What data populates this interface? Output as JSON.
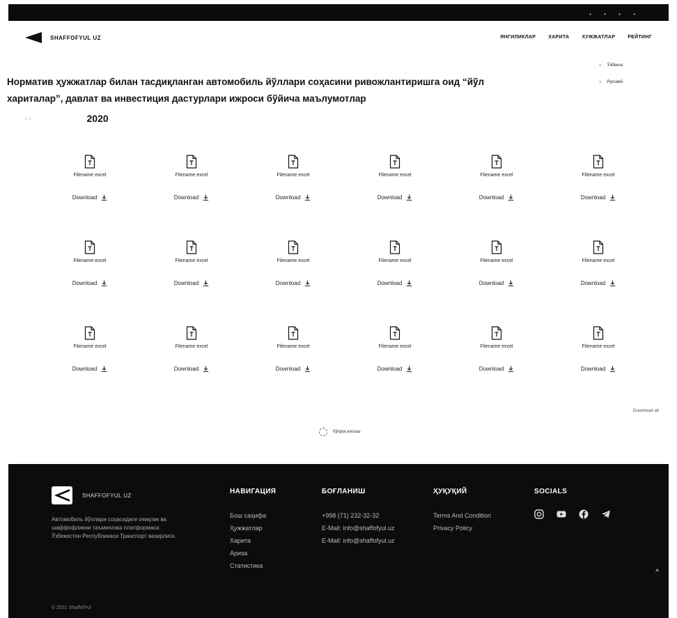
{
  "header": {
    "logo_text": "SHAFFOFYUL UZ",
    "nav": [
      "ЯНГИЛИКЛАР",
      "ХАРИТА",
      "ХУЖЖАТЛАР",
      "РЕЙТИНГ"
    ],
    "languages": [
      "Ўзбекча",
      "Русский"
    ]
  },
  "page": {
    "title": "Норматив ҳужжатлар билан тасдиқланган автомобиль йўллари соҳасини ривожлантиришга оид “йўл хариталар”, давлат ва инвестиция дастурлари ижроси бўйича маълумотлар",
    "year": "2020"
  },
  "files": {
    "filename_label": "Filename excel",
    "download_label": "Download",
    "count": 18
  },
  "download_all": "Download all",
  "loader_text": "Кўпроқ юклаш",
  "footer": {
    "logo_text": "SHAFFOFYUL UZ",
    "about": "Автомобиль йўллари соҳасидаги очиқлик ва шаффофликни таъминлаш платформаси. Ўзбекистон Республикаси Транспорт вазирлиги.",
    "nav_title": "НАВИГАЦИЯ",
    "nav_items": [
      "Бош саҳифа",
      "Ҳужжатлар",
      "Харита",
      "Ариза",
      "Статистика"
    ],
    "contact_title": "БОҒЛАНИШ",
    "contact_items": [
      "+998 (71) 232-32-32",
      "E-Mail: info@shaffofyul.uz",
      "E-Mail: info@shaffofyul.uz"
    ],
    "legal_title": "ҲУҚУҚИЙ",
    "legal_items": [
      "Terms And Condition",
      "Privacy Policy"
    ],
    "social_title": "SOCIALS",
    "copyright": "© 2021 ShaffofYul"
  },
  "colors": {
    "dark": "#0c0c0c",
    "text": "#111111"
  }
}
